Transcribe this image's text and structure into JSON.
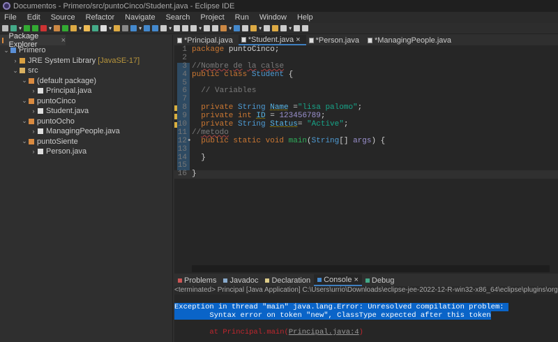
{
  "window": {
    "title": "Documentos - Primero/src/puntoCinco/Student.java - Eclipse IDE"
  },
  "menu": [
    "File",
    "Edit",
    "Source",
    "Refactor",
    "Navigate",
    "Search",
    "Project",
    "Run",
    "Window",
    "Help"
  ],
  "explorer": {
    "tab": "Package Explorer",
    "items": [
      {
        "label": "Primero",
        "depth": 0,
        "arrow": "⌄",
        "icon": "project",
        "color": "#5a8fd6"
      },
      {
        "label": "JRE System Library",
        "extra": "[JavaSE-17]",
        "depth": 1,
        "arrow": "›",
        "icon": "library",
        "color": "#d9a040"
      },
      {
        "label": "src",
        "depth": 1,
        "arrow": "⌄",
        "icon": "folder",
        "color": "#d9b060"
      },
      {
        "label": "(default package)",
        "depth": 2,
        "arrow": "⌄",
        "icon": "package",
        "color": "#d98a40"
      },
      {
        "label": "Principal.java",
        "depth": 3,
        "arrow": "›",
        "icon": "java-file",
        "color": "#ddd"
      },
      {
        "label": "puntoCinco",
        "depth": 2,
        "arrow": "⌄",
        "icon": "package",
        "color": "#d98a40"
      },
      {
        "label": "Student.java",
        "depth": 3,
        "arrow": "›",
        "icon": "java-file",
        "color": "#ddd"
      },
      {
        "label": "puntoOcho",
        "depth": 2,
        "arrow": "⌄",
        "icon": "package",
        "color": "#d98a40"
      },
      {
        "label": "ManagingPeople.java",
        "depth": 3,
        "arrow": "›",
        "icon": "java-file",
        "color": "#ddd"
      },
      {
        "label": "puntoSiente",
        "depth": 2,
        "arrow": "⌄",
        "icon": "package",
        "color": "#d98a40"
      },
      {
        "label": "Person.java",
        "depth": 3,
        "arrow": "›",
        "icon": "java-file",
        "color": "#ddd"
      }
    ]
  },
  "editor": {
    "tabs": [
      {
        "label": "*Principal.java"
      },
      {
        "label": "*Student.java",
        "active": true
      },
      {
        "label": "*Person.java"
      },
      {
        "label": "*ManagingPeople.java"
      }
    ],
    "lines": [
      {
        "n": "1",
        "tokens": [
          [
            "kw",
            "package "
          ],
          [
            "df",
            "puntoCinco;"
          ]
        ]
      },
      {
        "n": "2",
        "tokens": []
      },
      {
        "n": "3",
        "tokens": [
          [
            "cm",
            "//"
          ],
          [
            "cml",
            "Nombre"
          ],
          [
            "cm",
            " "
          ],
          [
            "cml",
            "de"
          ],
          [
            "cm",
            " "
          ],
          [
            "cml",
            "la"
          ],
          [
            "cm",
            " "
          ],
          [
            "cml",
            "calse"
          ]
        ]
      },
      {
        "n": "4",
        "tokens": [
          [
            "kw",
            "public class "
          ],
          [
            "ty",
            "Student "
          ],
          [
            "df",
            "{"
          ]
        ]
      },
      {
        "n": "5",
        "tokens": []
      },
      {
        "n": "6",
        "tokens": [
          [
            "cm",
            "  // Variables"
          ]
        ]
      },
      {
        "n": "7",
        "tokens": []
      },
      {
        "n": "8",
        "mark": "warn",
        "tokens": [
          [
            "kw",
            "  private "
          ],
          [
            "ty",
            "String "
          ],
          [
            "fld",
            "Name"
          ],
          [
            "df",
            " ="
          ],
          [
            "str",
            "\"lisa palomo\""
          ],
          [
            "df",
            ";"
          ]
        ]
      },
      {
        "n": "9",
        "mark": "warn",
        "tokens": [
          [
            "kw",
            "  private int "
          ],
          [
            "fld",
            "ID"
          ],
          [
            "df",
            " = "
          ],
          [
            "nm",
            "123456789"
          ],
          [
            "df",
            ";"
          ]
        ]
      },
      {
        "n": "10",
        "mark": "warn",
        "tokens": [
          [
            "kw",
            "  private "
          ],
          [
            "ty",
            "String "
          ],
          [
            "fld",
            "Status"
          ],
          [
            "df",
            "= "
          ],
          [
            "str",
            "\"Active\""
          ],
          [
            "df",
            ";"
          ]
        ]
      },
      {
        "n": "11",
        "tokens": [
          [
            "cm",
            "//"
          ],
          [
            "cml",
            "metodo"
          ]
        ]
      },
      {
        "n": "12",
        "mark": "dot",
        "tokens": [
          [
            "kw",
            "  public static void "
          ],
          [
            "mt",
            "main"
          ],
          [
            "df",
            "("
          ],
          [
            "ty",
            "String"
          ],
          [
            "df",
            "[] "
          ],
          [
            "nm",
            "args"
          ],
          [
            "df",
            ") {"
          ]
        ]
      },
      {
        "n": "13",
        "tokens": []
      },
      {
        "n": "14",
        "tokens": [
          [
            "df",
            "  }"
          ]
        ]
      },
      {
        "n": "15",
        "tokens": []
      },
      {
        "n": "16",
        "tokens": [
          [
            "df",
            "}"
          ]
        ]
      }
    ]
  },
  "console": {
    "tabs": [
      {
        "label": "Problems"
      },
      {
        "label": "Javadoc"
      },
      {
        "label": "Declaration"
      },
      {
        "label": "Console",
        "active": true
      },
      {
        "label": "Debug"
      }
    ],
    "terminated": "<terminated> Principal [Java Application] C:\\Users\\urrio\\Downloads\\eclipse-jee-2022-12-R-win32-x86_64\\eclipse\\plugins\\org.eclipse.justj",
    "line1": "Exception in thread \"main\" java.lang.Error: Unresolved compilation problem: ",
    "line2": "\tSyntax error on token \"new\", ClassType expected after this token",
    "at": "\tat Principal.main(",
    "link": "Principal.java:4",
    "close": ")"
  }
}
